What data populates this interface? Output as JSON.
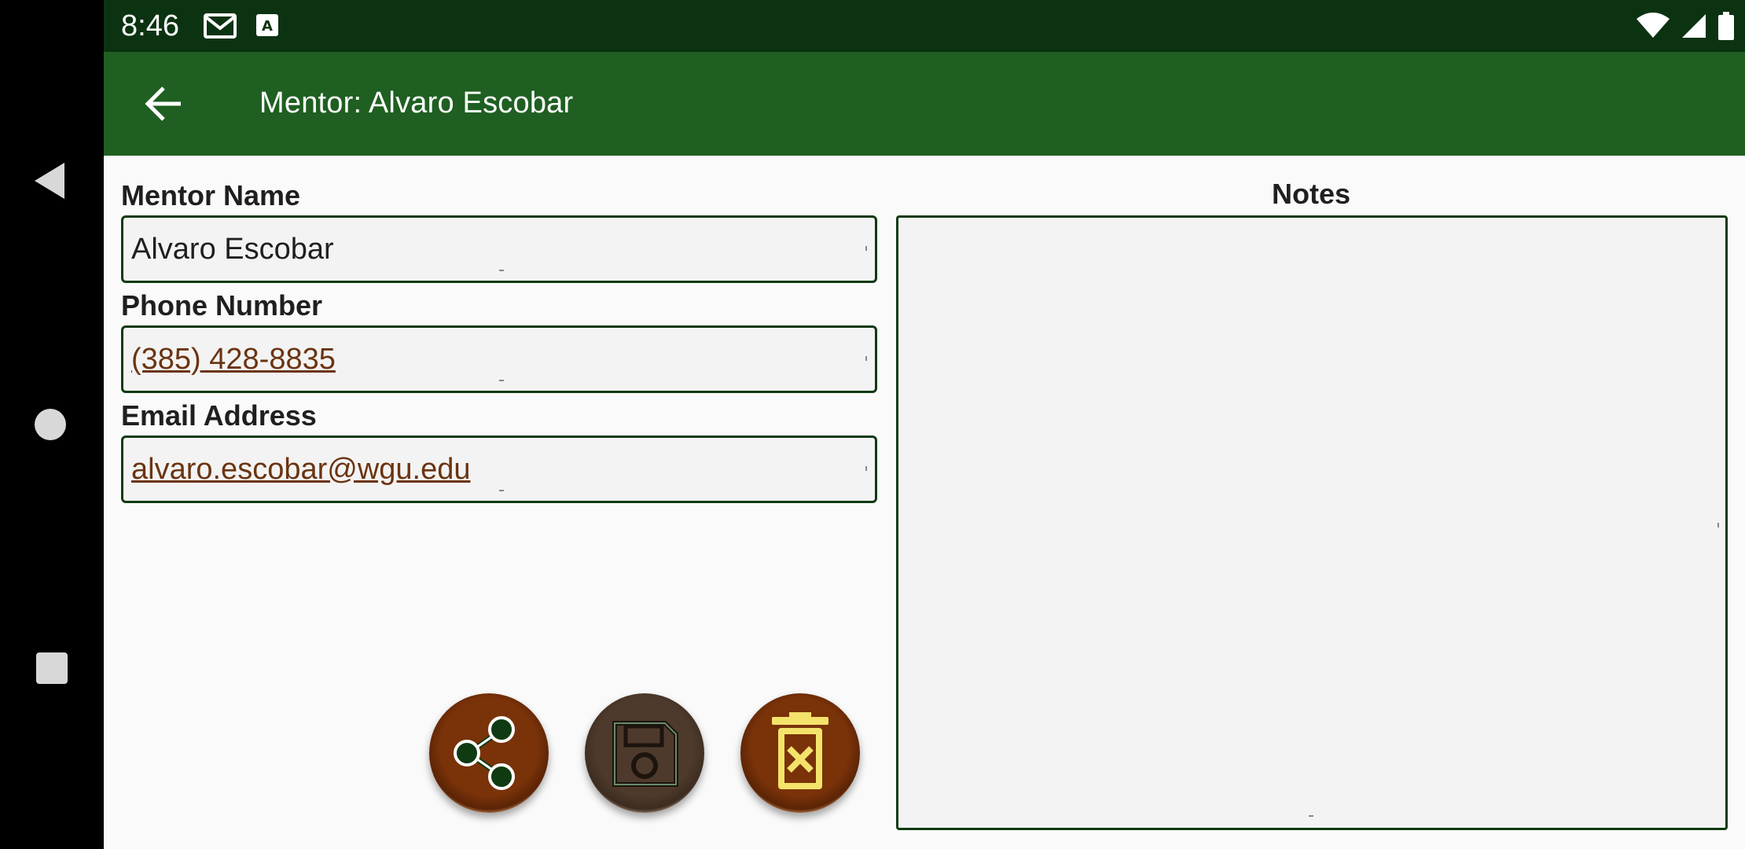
{
  "status_bar": {
    "time": "8:46",
    "icons": [
      "gmail-icon",
      "text-a-icon",
      "wifi-icon",
      "cell-signal-icon",
      "battery-icon"
    ]
  },
  "nav_bar": {
    "buttons": [
      "back-triangle-icon",
      "home-circle-icon",
      "recents-square-icon"
    ]
  },
  "app_bar": {
    "title": "Mentor: Alvaro Escobar",
    "back_icon": "arrow-left-icon",
    "background": "#1f5f21"
  },
  "form": {
    "mentor_name_label": "Mentor Name",
    "mentor_name_value": "Alvaro Escobar",
    "phone_label": "Phone Number",
    "phone_value": "(385) 428-8835",
    "email_label": "Email Address",
    "email_value": "alvaro.escobar@wgu.edu",
    "notes_label": "Notes",
    "notes_value": ""
  },
  "actions": {
    "share": "share-icon",
    "save": "save-floppy-icon",
    "delete": "trash-delete-icon"
  },
  "colors": {
    "status_bar": "#0c3311",
    "accent_brown": "#7a3209",
    "link": "#6b3411",
    "border": "#0f3a12",
    "delete_yellow": "#f4e36b"
  }
}
